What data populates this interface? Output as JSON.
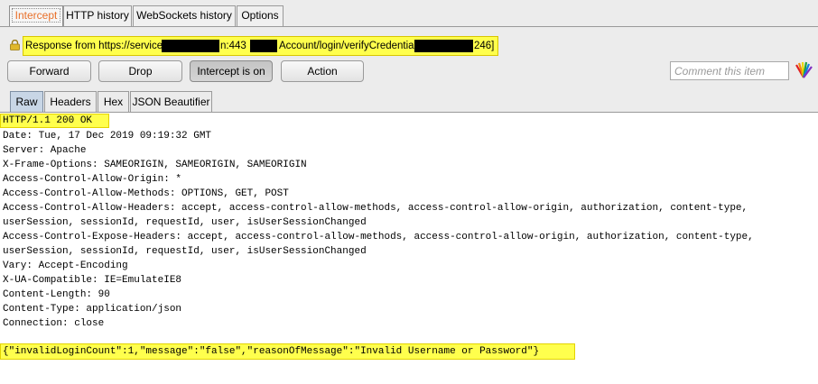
{
  "tabs": [
    {
      "label": "Intercept"
    },
    {
      "label": "HTTP history"
    },
    {
      "label": "WebSockets history"
    },
    {
      "label": "Options"
    }
  ],
  "response_bar": {
    "prefix": "Response from https://services",
    "segment_port": "n:443",
    "segment_path": "Account/login/verifyCredential",
    "segment_end": "246]"
  },
  "buttons": {
    "forward": "Forward",
    "drop": "Drop",
    "intercept": "Intercept is on",
    "action": "Action"
  },
  "comment": {
    "placeholder": "Comment this item"
  },
  "subtabs": [
    {
      "label": "Raw"
    },
    {
      "label": "Headers"
    },
    {
      "label": "Hex"
    },
    {
      "label": "JSON Beautifier"
    }
  ],
  "response": {
    "status": "HTTP/1.1 200 OK",
    "headers": [
      "Date: Tue, 17 Dec 2019 09:19:32 GMT",
      "Server: Apache",
      "X-Frame-Options: SAMEORIGIN, SAMEORIGIN, SAMEORIGIN",
      "Access-Control-Allow-Origin: *",
      "Access-Control-Allow-Methods: OPTIONS, GET, POST",
      "Access-Control-Allow-Headers: accept, access-control-allow-methods, access-control-allow-origin, authorization, content-type,",
      "userSession, sessionId, requestId, user, isUserSessionChanged",
      "Access-Control-Expose-Headers: accept, access-control-allow-methods, access-control-allow-origin, authorization, content-type,",
      "userSession, sessionId, requestId, user, isUserSessionChanged",
      "Vary: Accept-Encoding",
      "X-UA-Compatible: IE=EmulateIE8",
      "Content-Length: 90",
      "Content-Type: application/json",
      "Connection: close"
    ],
    "body": "{\"invalidLoginCount\":1,\"message\":\"false\",\"reasonOfMessage\":\"Invalid Username or Password\"}"
  },
  "colors": {
    "highlight": "#ffff4d",
    "active_tab_text": "#e8702a",
    "active_subtab": "#c8d6e6"
  }
}
